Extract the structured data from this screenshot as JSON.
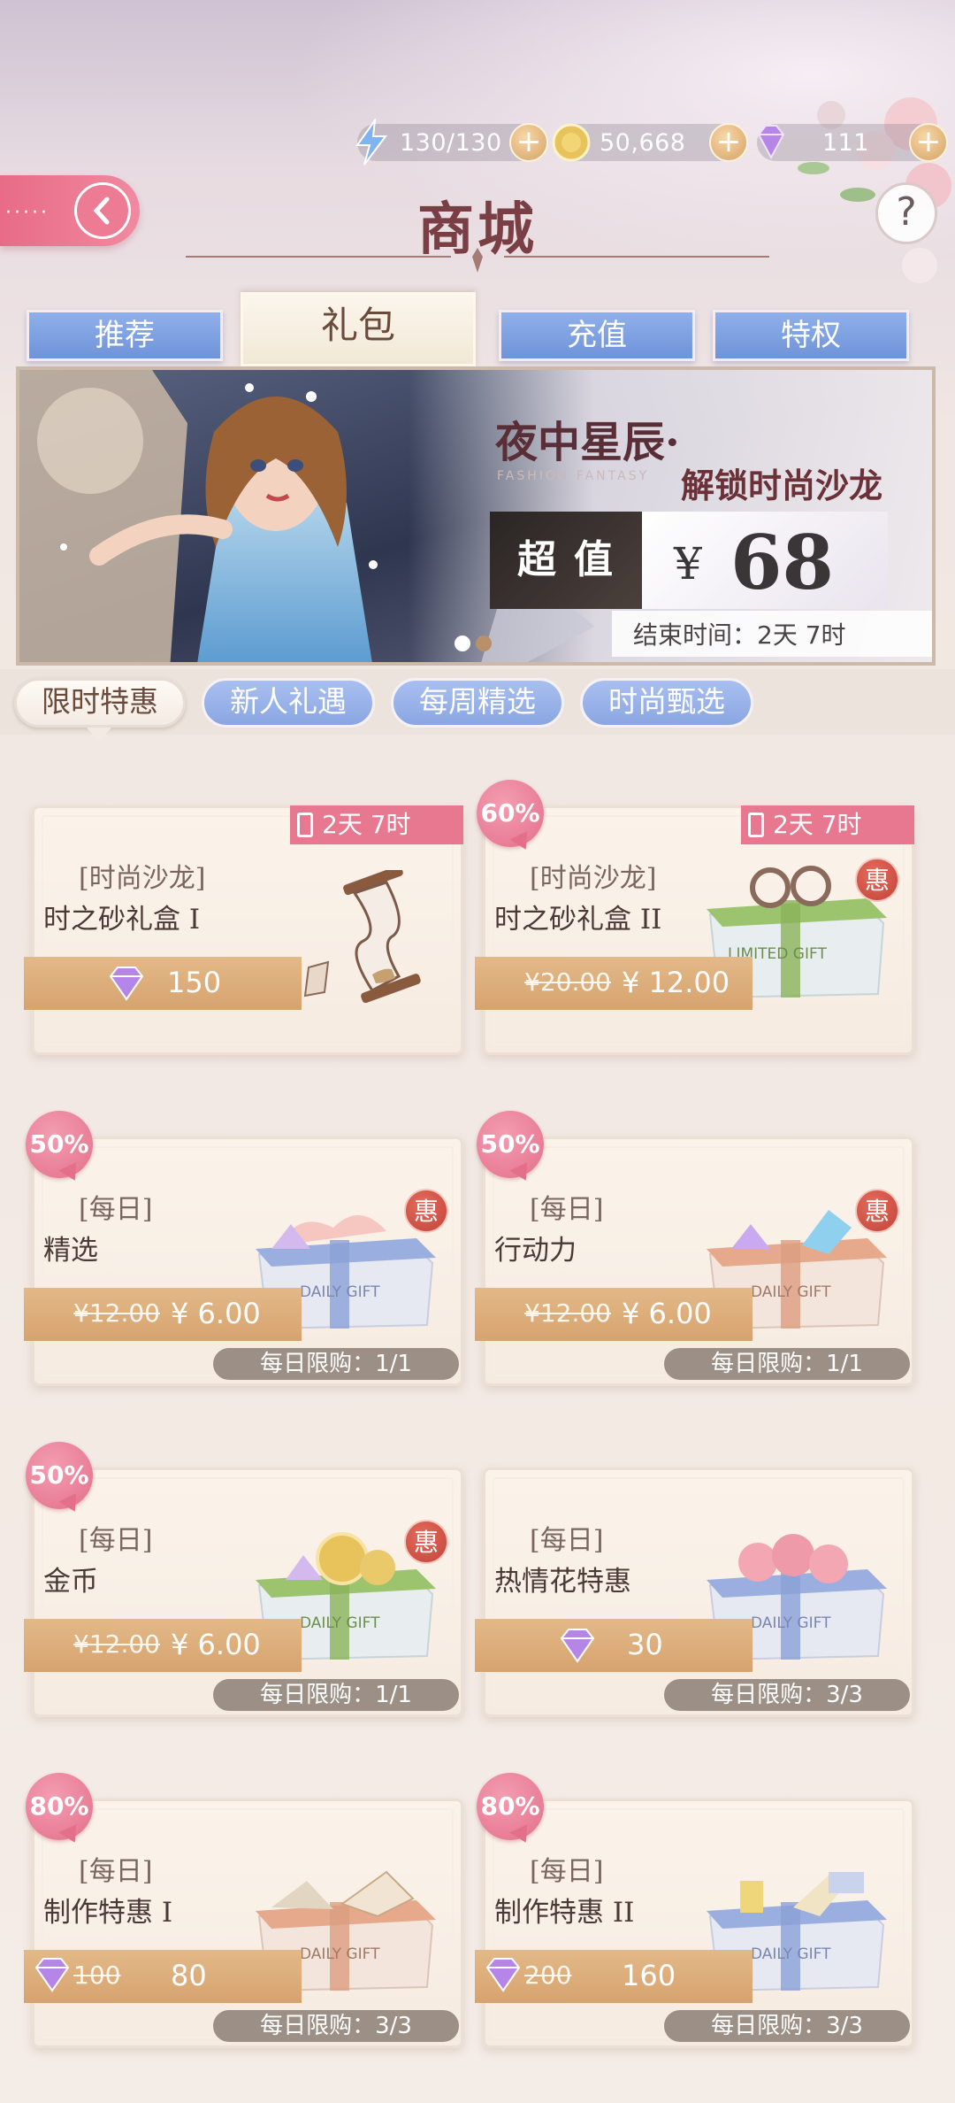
{
  "resources": {
    "energy": "130/130",
    "coins": "50,668",
    "diamonds": "111"
  },
  "header": {
    "title": "商城",
    "help": "?"
  },
  "tabs": [
    {
      "label": "推荐",
      "active": false
    },
    {
      "label": "礼包",
      "active": true
    },
    {
      "label": "充值",
      "active": false
    },
    {
      "label": "特权",
      "active": false
    }
  ],
  "banner": {
    "title_line1": "夜中星辰·",
    "title_line2": "解锁时尚沙龙",
    "watermark": "FASHION FANTASY",
    "badge": "超值",
    "currency": "¥",
    "price": "68",
    "end_time": "结束时间：2天 7时"
  },
  "subtabs": [
    {
      "label": "限时特惠",
      "active": true
    },
    {
      "label": "新人礼遇",
      "active": false
    },
    {
      "label": "每周精选",
      "active": false
    },
    {
      "label": "时尚甄选",
      "active": false
    }
  ],
  "cards": [
    {
      "category": "[时尚沙龙]",
      "name": "时之砂礼盒 I",
      "timer": "2天 7时",
      "price_type": "diamond",
      "price": "150",
      "icon": "hourglass-icon"
    },
    {
      "category": "[时尚沙龙]",
      "name": "时之砂礼盒 II",
      "timer": "2天 7时",
      "discount": "60%",
      "price_type": "cash",
      "old_price": "¥20.00",
      "new_price": "¥ 12.00",
      "badge": "惠",
      "gift_label": "LIMITED GIFT"
    },
    {
      "category": "[每日]",
      "name": "精选",
      "discount": "50%",
      "price_type": "cash",
      "old_price": "¥12.00",
      "new_price": "¥ 6.00",
      "badge": "惠",
      "limit": "每日限购：1/1",
      "gift_label": "DAILY GIFT"
    },
    {
      "category": "[每日]",
      "name": "行动力",
      "discount": "50%",
      "price_type": "cash",
      "old_price": "¥12.00",
      "new_price": "¥ 6.00",
      "badge": "惠",
      "limit": "每日限购：1/1",
      "gift_label": "DAILY GIFT"
    },
    {
      "category": "[每日]",
      "name": "金币",
      "discount": "50%",
      "price_type": "cash",
      "old_price": "¥12.00",
      "new_price": "¥ 6.00",
      "badge": "惠",
      "limit": "每日限购：1/1",
      "gift_label": "DAILY GIFT"
    },
    {
      "category": "[每日]",
      "name": "热情花特惠",
      "price_type": "diamond",
      "price": "30",
      "limit": "每日限购：3/3",
      "gift_label": "DAILY GIFT"
    },
    {
      "category": "[每日]",
      "name": "制作特惠 I",
      "discount": "80%",
      "price_type": "diamond-old",
      "old_price": "100",
      "new_price": "80",
      "limit": "每日限购：3/3",
      "gift_label": "DAILY GIFT"
    },
    {
      "category": "[每日]",
      "name": "制作特惠 II",
      "discount": "80%",
      "price_type": "diamond-old",
      "old_price": "200",
      "new_price": "160",
      "limit": "每日限购：3/3",
      "gift_label": "DAILY GIFT"
    }
  ],
  "colors": {
    "accent_pink": "#e7788f",
    "tab_blue": "#7f9fe0",
    "price_bar": "#dcae7b",
    "title": "#7a3f44"
  }
}
